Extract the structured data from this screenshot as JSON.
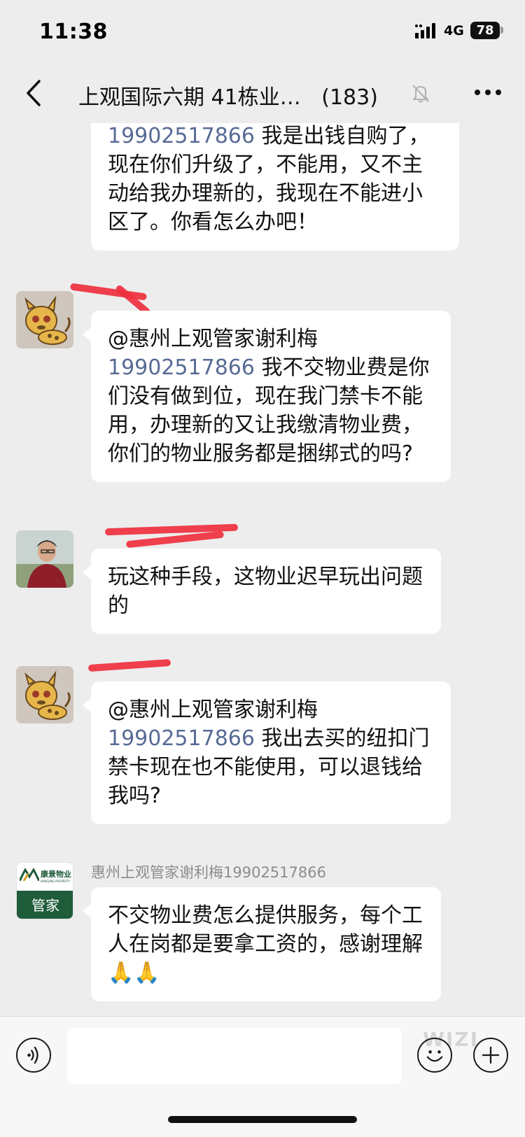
{
  "status_bar": {
    "time": "11:38",
    "network": "4G",
    "battery": "78"
  },
  "header": {
    "title": "上观国际六期 41栋业…",
    "member_count": "(183)",
    "icons": [
      "back-chevron-icon",
      "mute-bell-icon",
      "more-dots-icon"
    ]
  },
  "messages": [
    {
      "sender": "",
      "segments": {
        "phone": "19902517866",
        "text": " 我是出钱自购了，现在你们升级了，不能用，又不主动给我办理新的，我现在不能进小区了。你看怎么办吧！"
      }
    },
    {
      "sender": "",
      "segments": {
        "mention": "@惠州上观管家谢利梅",
        "phone": "19902517866",
        "text": " 我不交物业费是你们没有做到位，现在我门禁卡不能用，办理新的又让我缴清物业费，你们的物业服务都是捆绑式的吗?"
      }
    },
    {
      "sender": "",
      "segments": {
        "text": "玩这种手段，这物业迟早玩出问题的"
      }
    },
    {
      "sender": "",
      "segments": {
        "mention": "@惠州上观管家谢利梅",
        "phone": "19902517866",
        "text": " 我出去买的纽扣门禁卡现在也不能使用，可以退钱给我吗?"
      }
    },
    {
      "sender": "惠州上观管家谢利梅19902517866",
      "avatar_logo_text": "康景物业",
      "avatar_logo_subtext": "KANGJING PROPERTY",
      "avatar_label": "管家",
      "segments": {
        "text": "不交物业费怎么提供服务，每个工人在岗都是要拿工资的，感谢理解🙏🙏"
      }
    }
  ],
  "input_bar": {
    "value": "",
    "icons": [
      "voice-icon",
      "emoji-icon",
      "plus-icon"
    ],
    "watermark": "WIZI"
  },
  "colors": {
    "background": "#ededed",
    "bubble": "#ffffff",
    "link": "#576b95",
    "redaction": "#ef2f3e",
    "logo_green": "#1f5c3a"
  }
}
